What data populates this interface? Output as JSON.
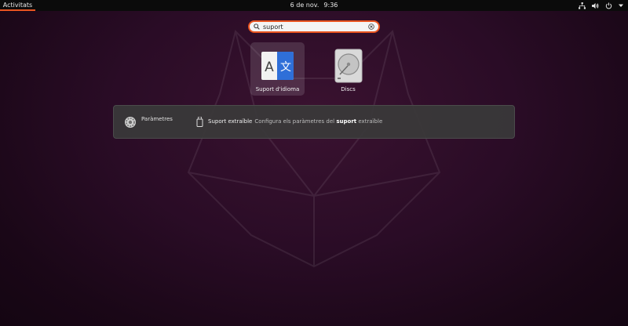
{
  "topbar": {
    "activities_label": "Activitats",
    "clock_date": "6 de nov.",
    "clock_time": "9:36",
    "icons": [
      "network-icon",
      "volume-icon",
      "power-icon"
    ]
  },
  "search": {
    "value": "suport",
    "icons": [
      "search-icon",
      "clear-icon"
    ]
  },
  "apps": [
    {
      "label": "Suport d'idioma",
      "icon": "language-support-icon",
      "selected": true
    },
    {
      "label": "Discs",
      "icon": "disks-icon",
      "selected": false
    }
  ],
  "provider": {
    "name": "Paràmetres",
    "icon": "settings-icon",
    "result": {
      "icon": "usb-drive-icon",
      "title": "Suport extraïble",
      "desc_prefix": "Configura els paràmetres del",
      "desc_highlight": "suport",
      "desc_suffix": "extraïble"
    }
  },
  "colors": {
    "accent": "#e95420",
    "background": "#2a0c26",
    "topbar": "#0b0b0b",
    "language_icon_blue": "#2f6fd8"
  }
}
